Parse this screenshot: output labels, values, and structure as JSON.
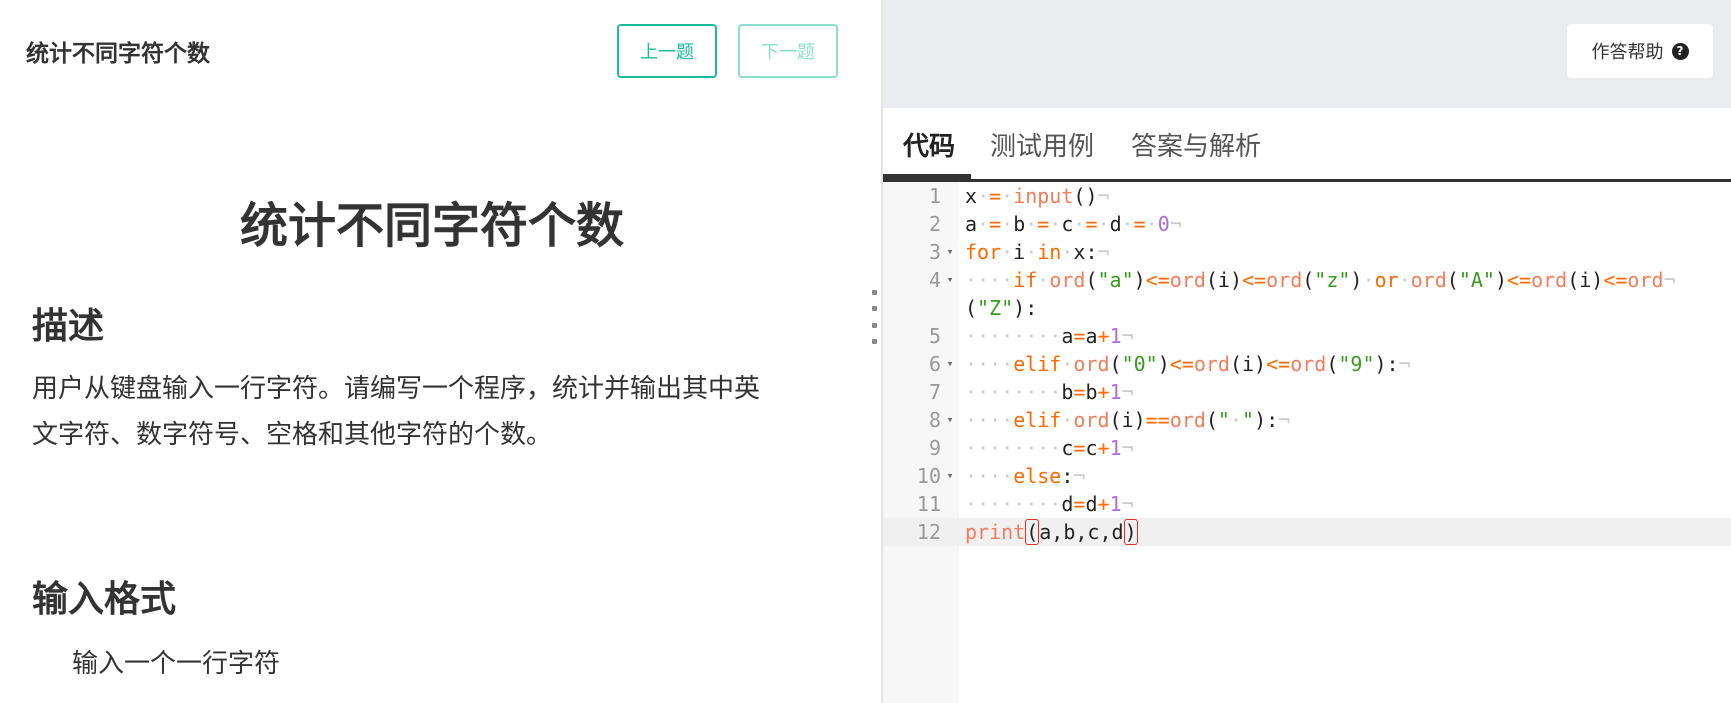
{
  "problem": {
    "title": "统计不同字符个数",
    "heading": "统计不同字符个数",
    "prev_label": "上一题",
    "next_label": "下一题",
    "description_title": "描述",
    "description_line1": "用户从键盘输入一行字符。请编写一个程序，统计并输出其中英",
    "description_line2": "文字符、数字符号、空格和其他字符的个数。",
    "input_title": "输入格式",
    "input_text": "输入一个一行字符"
  },
  "toolbar": {
    "help_label": "作答帮助",
    "help_icon": "question-circle-icon"
  },
  "tabs": [
    {
      "label": "代码",
      "active": true
    },
    {
      "label": "测试用例",
      "active": false
    },
    {
      "label": "答案与解析",
      "active": false
    }
  ],
  "editor": {
    "line_numbers": [
      "1",
      "2",
      "3",
      "4",
      "",
      "5",
      "6",
      "7",
      "8",
      "9",
      "10",
      "11",
      "12"
    ],
    "fold_lines": [
      "3",
      "4",
      "6",
      "8",
      "10"
    ],
    "current_line": "12",
    "code_lines": [
      "x = input()",
      "a = b = c = d = 0",
      "for i in x:",
      "    if ord(\"a\")<=ord(i)<=ord(\"z\") or ord(\"A\")<=ord(i)<=ord",
      "(\"Z\"):",
      "        a=a+1",
      "    elif ord(\"0\")<=ord(i)<=ord(\"9\"):",
      "        b=b+1",
      "    elif ord(i)==ord(\" \"):",
      "        c=c+1",
      "    else:",
      "        d=d+1",
      "print(a,b,c,d)"
    ]
  },
  "colors": {
    "accent": "#1bbc9b",
    "keyword": "#ff6a00",
    "number": "#ad6ade",
    "string": "#3a9a20",
    "bracket_match": "#e0302a"
  }
}
